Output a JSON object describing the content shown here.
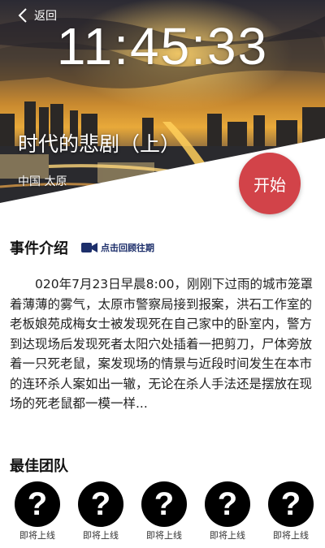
{
  "header": {
    "back_label": "返回",
    "clock": "11:45:33"
  },
  "case": {
    "title": "时代的悲剧（上）",
    "location": "中国  太原",
    "start_label": "开始"
  },
  "intro": {
    "heading": "事件介绍",
    "review_label": "点击回顾往期",
    "text": "020年7月23日早晨8:00，刚刚下过雨的城市笼罩着薄薄的雾气，太原市警察局接到报案，洪石工作室的老板娘苑成梅女士被发现死在自己家中的卧室内，警方到达现场后发现死者太阳穴处插着一把剪刀，尸体旁放着一只死老鼠，案发现场的情景与近段时间发生在本市的连环杀人案如出一辙，无论在杀人手法还是摆放在现场的死老鼠都一模一样..."
  },
  "team": {
    "heading": "最佳团队",
    "members": [
      {
        "symbol": "?",
        "caption": "即将上线"
      },
      {
        "symbol": "?",
        "caption": "即将上线"
      },
      {
        "symbol": "?",
        "caption": "即将上线"
      },
      {
        "symbol": "?",
        "caption": "即将上线"
      },
      {
        "symbol": "?",
        "caption": "即将上线"
      }
    ]
  },
  "colors": {
    "accent": "#d24349",
    "link": "#1d2f6b"
  }
}
